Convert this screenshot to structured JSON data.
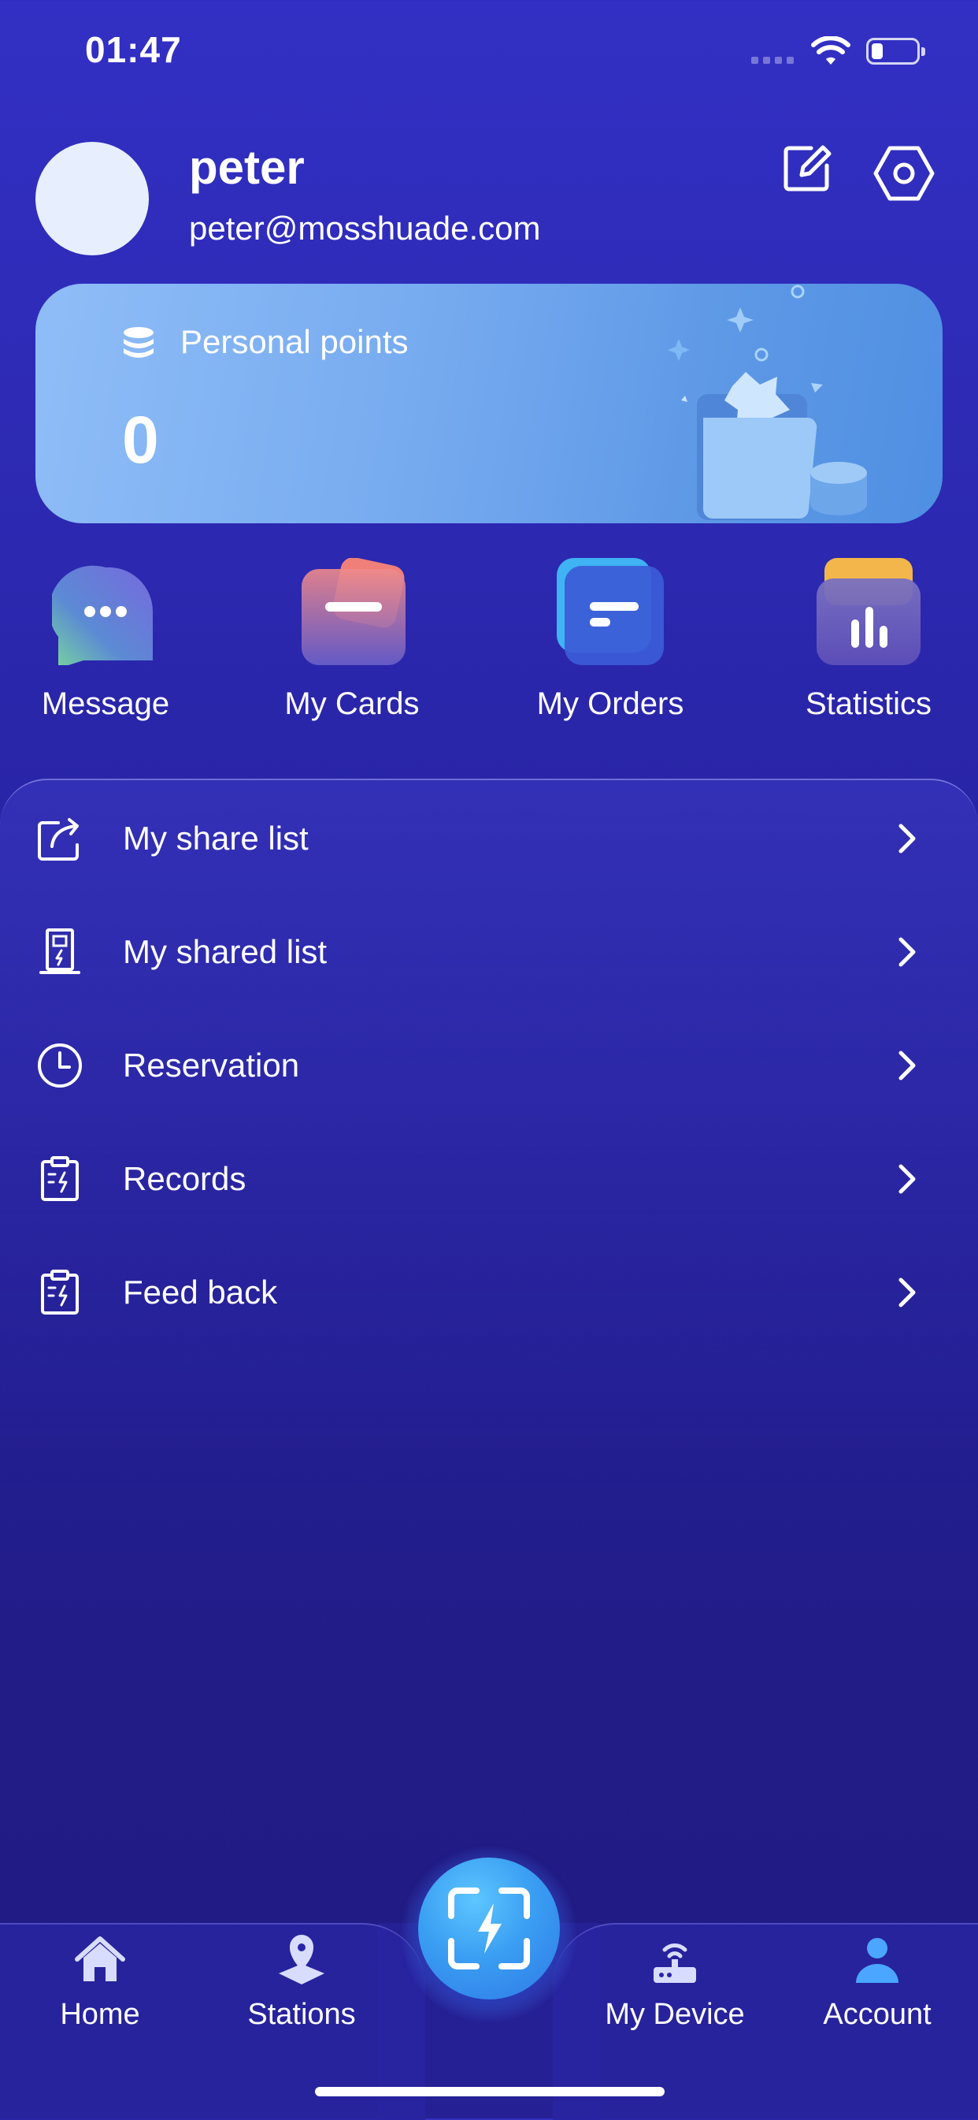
{
  "status_bar": {
    "time": "01:47"
  },
  "profile": {
    "name": "peter",
    "email": "peter@mosshuade.com",
    "edit_icon": "edit-icon",
    "settings_icon": "gear-icon"
  },
  "points": {
    "label": "Personal points",
    "value": "0",
    "icon": "coins-stack-icon"
  },
  "quick_actions": [
    {
      "label": "Message",
      "icon": "message-icon"
    },
    {
      "label": "My Cards",
      "icon": "card-icon"
    },
    {
      "label": "My Orders",
      "icon": "orders-icon"
    },
    {
      "label": "Statistics",
      "icon": "statistics-icon"
    }
  ],
  "menu": [
    {
      "label": "My share list",
      "icon": "share-icon"
    },
    {
      "label": "My shared list",
      "icon": "charger-icon"
    },
    {
      "label": "Reservation",
      "icon": "clock-icon"
    },
    {
      "label": "Records",
      "icon": "clipboard-icon"
    },
    {
      "label": "Feed back",
      "icon": "clipboard-icon"
    }
  ],
  "nav": [
    {
      "label": "Home",
      "icon": "home-icon"
    },
    {
      "label": "Stations",
      "icon": "map-pin-icon"
    },
    {
      "label": "My Device",
      "icon": "router-icon"
    },
    {
      "label": "Account",
      "icon": "user-icon",
      "active_color": "#4aa6ff"
    }
  ],
  "colors": {
    "background_top": "#3230c4",
    "background_bottom": "#211b84",
    "accent": "#4aa6ff",
    "card": "#78acf0"
  }
}
